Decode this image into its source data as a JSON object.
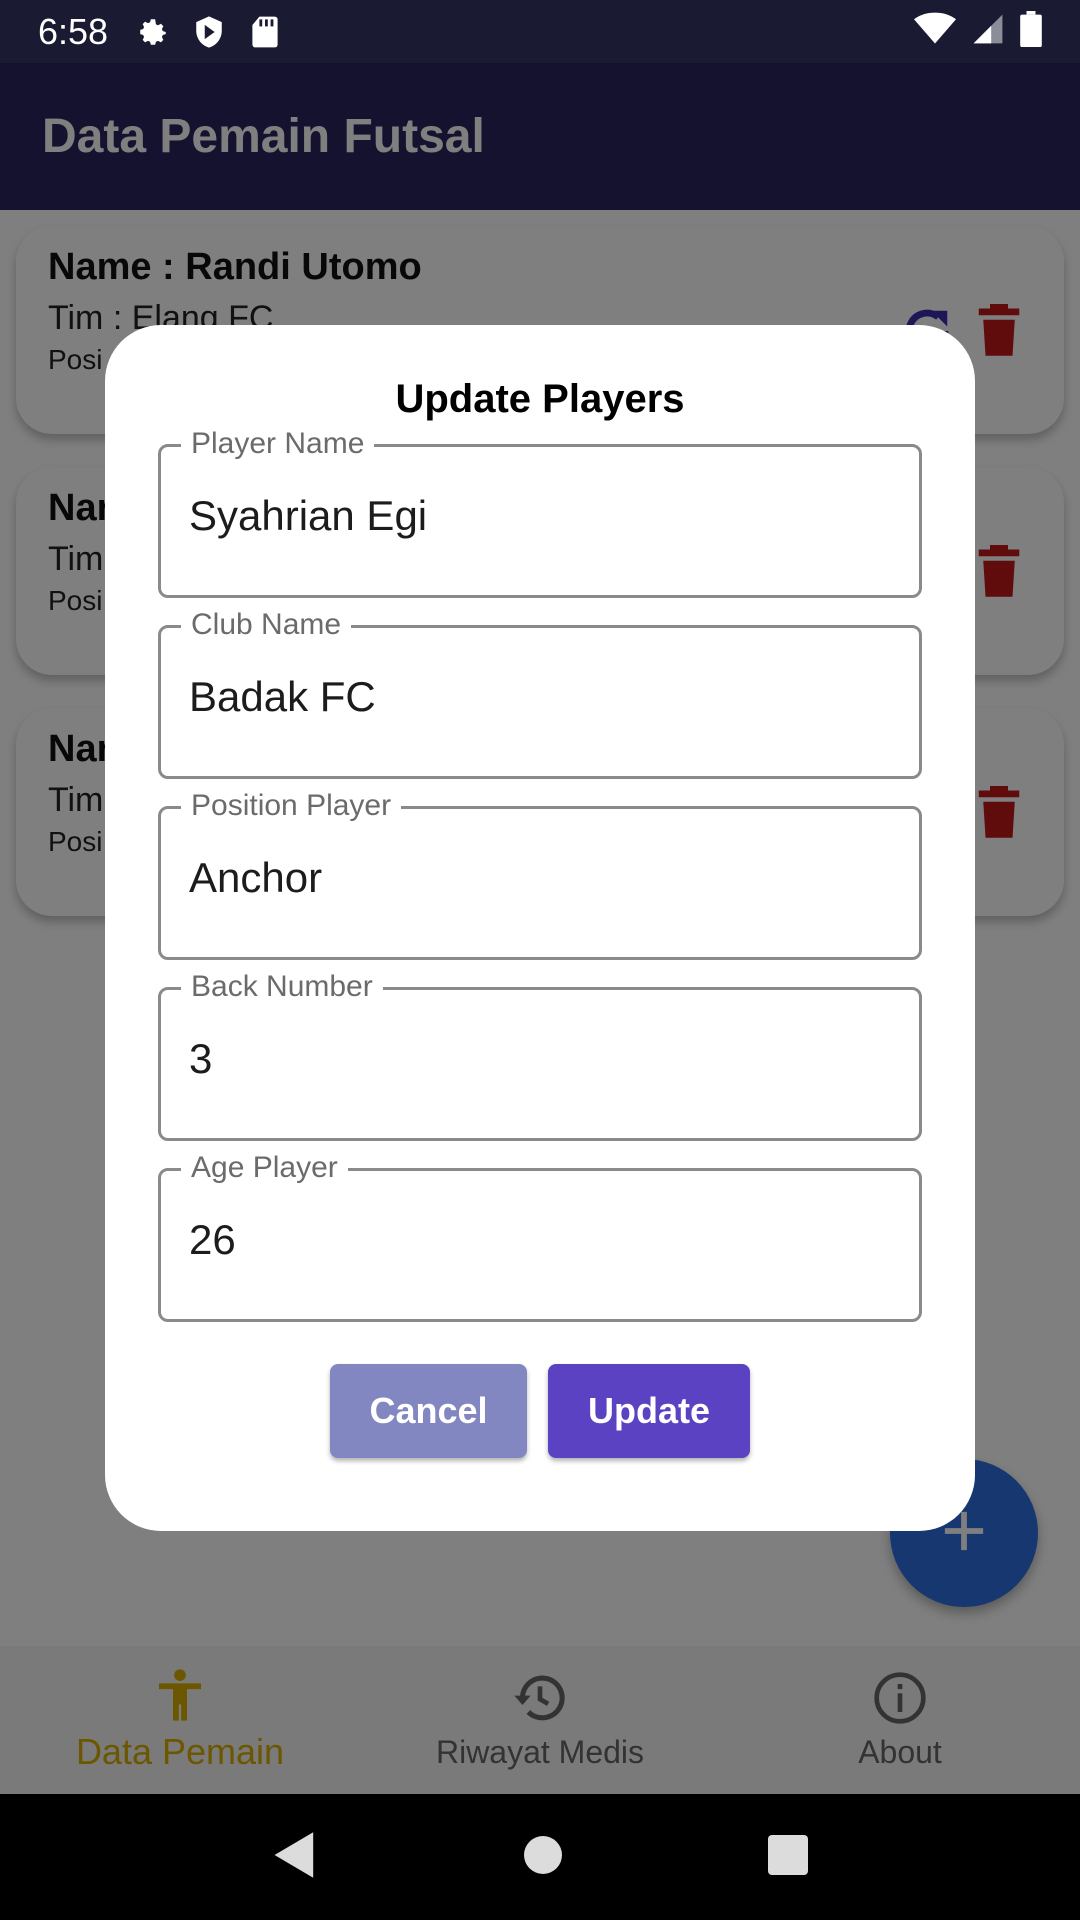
{
  "status_bar": {
    "time": "6:58"
  },
  "app_bar": {
    "title": "Data Pemain Futsal"
  },
  "cards": [
    {
      "name": "Name : Randi Utomo",
      "team": "Tim : Elang FC",
      "position": "Posi"
    },
    {
      "name": "Nar",
      "team": "Tim",
      "position": "Posi"
    },
    {
      "name": "Nar",
      "team": "Tim",
      "position": "Posi"
    }
  ],
  "dialog": {
    "title": "Update Players",
    "fields": [
      {
        "label": "Player Name",
        "value": "Syahrian Egi"
      },
      {
        "label": "Club Name",
        "value": "Badak FC"
      },
      {
        "label": "Position Player",
        "value": "Anchor"
      },
      {
        "label": "Back Number",
        "value": "3"
      },
      {
        "label": "Age Player",
        "value": "26"
      }
    ],
    "cancel_label": "Cancel",
    "update_label": "Update"
  },
  "bottom_nav": {
    "items": [
      {
        "label": "Data Pemain",
        "icon": "person-icon",
        "active": true
      },
      {
        "label": "Riwayat Medis",
        "icon": "history-icon",
        "active": false
      },
      {
        "label": "About",
        "icon": "info-icon",
        "active": false
      }
    ]
  },
  "colors": {
    "app_bar": "#2a2560",
    "update_button": "#5b42c3",
    "cancel_button": "#8287c2",
    "active_nav": "#d9ad00",
    "delete_icon": "#c01818",
    "fab": "#2f6fe0"
  }
}
